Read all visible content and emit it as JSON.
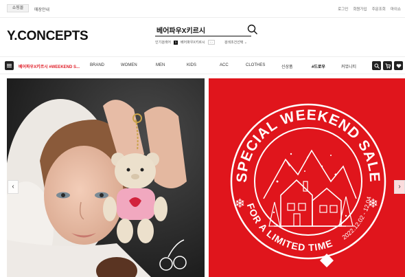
{
  "topbar": {
    "tabs": [
      "쇼핑몰",
      "매장안내"
    ],
    "links": [
      "로그인",
      "회원가입",
      "주문조회",
      "마이쇼"
    ]
  },
  "header": {
    "logo": "Y.CONCEPTS",
    "search_value": "베어파우X키르시",
    "popular_label": "인기검색어",
    "popular_rank": "1",
    "popular_term": "베어파우X키르시",
    "filter_label": "검색조건선택"
  },
  "nav": {
    "highlight": "베어파우X키르시 #WEEKEND S...",
    "items": [
      "BRAND",
      "WOMEN",
      "MEN",
      "KIDS",
      "ACC",
      "CLOTHES",
      "신상품"
    ],
    "bold_item": "#드로우",
    "community": "커뮤니티"
  },
  "banner_right": {
    "arc_top": "SPECIAL WEEKEND SALE",
    "arc_bottom": "FOR A LIMITED TIME",
    "date": "2022.12.02 - 12.04"
  },
  "colors": {
    "brand_red": "#e0151c",
    "accent_red": "#e0202a",
    "dark": "#222222"
  },
  "icons": [
    "search-icon",
    "menu-icon",
    "search-icon",
    "cart-icon",
    "heart-icon",
    "chevron-left-icon",
    "chevron-right-icon"
  ],
  "carousel": {
    "prev": "‹",
    "next": "›"
  }
}
